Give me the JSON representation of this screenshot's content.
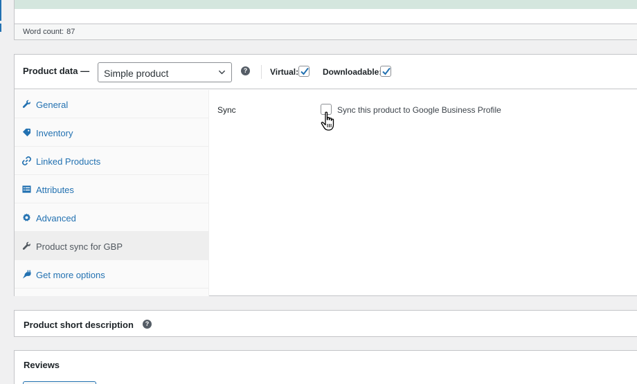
{
  "editor": {
    "word_count_label": "Word count:",
    "word_count_value": "87"
  },
  "product_data": {
    "title": "Product data —",
    "product_type": "Simple product",
    "help_icon": "?",
    "virtual_label": "Virtual:",
    "virtual_checked": true,
    "downloadable_label": "Downloadable:",
    "downloadable_checked": true,
    "tabs": [
      {
        "label": "General",
        "icon": "wrench-icon",
        "active": false
      },
      {
        "label": "Inventory",
        "icon": "tag-icon",
        "active": false
      },
      {
        "label": "Linked Products",
        "icon": "link-icon",
        "active": false
      },
      {
        "label": "Attributes",
        "icon": "list-icon",
        "active": false
      },
      {
        "label": "Advanced",
        "icon": "gear-icon",
        "active": false
      },
      {
        "label": "Product sync for GBP",
        "icon": "wrench-icon",
        "active": true
      },
      {
        "label": "Get more options",
        "icon": "plugin-icon",
        "active": false
      }
    ],
    "panel": {
      "sync_label": "Sync",
      "sync_checkbox_text": "Sync this product to Google Business Profile",
      "sync_checked": false
    }
  },
  "short_description": {
    "title": "Product short description",
    "help_icon": "?"
  },
  "reviews": {
    "title": "Reviews"
  },
  "colors": {
    "link": "#2271b1",
    "border": "#c3c4c7",
    "active_tab": "#eeeeee"
  }
}
